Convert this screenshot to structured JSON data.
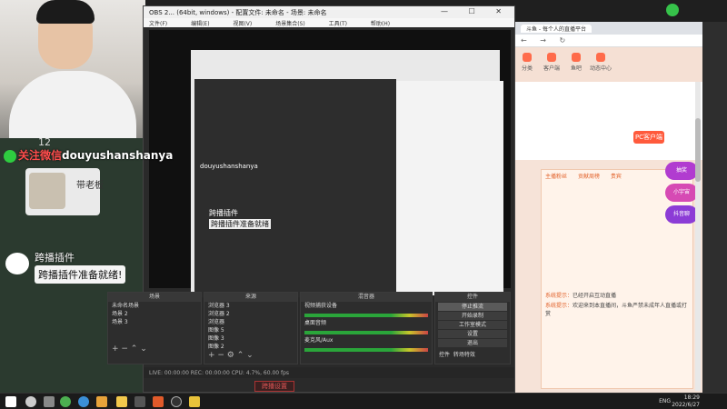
{
  "webcam": {
    "number": "12"
  },
  "overlay": {
    "chat_user_prefix": "关注微信",
    "chat_user_handle": "douyushanshanya",
    "plugin_card_title": "带老板",
    "notice_title": "跨播插件",
    "notice_message": "跨播插件准备就绪!"
  },
  "obs": {
    "title": "OBS 2... (64bit, windows) - 配置文件: 未命名 - 场景: 未命名",
    "menu": [
      "文件(F)",
      "编辑(E)",
      "视图(V)",
      "场景集合(S)",
      "工具(T)",
      "帮助(H)"
    ],
    "window_buttons": "— ☐ ✕",
    "preview_label": "douyushanshanya",
    "preview_sub1": "跨播插件",
    "preview_sub2": "跨播插件准备就绪",
    "docks": {
      "scenes": {
        "title": "场景",
        "items": [
          "未命名场景",
          "场景 2",
          "场景 3"
        ]
      },
      "sources": {
        "title": "来源",
        "items": [
          "浏览器 3",
          "浏览器 2",
          "浏览器",
          "图像 5",
          "图像 3",
          "图像 2"
        ]
      },
      "mixer": {
        "title": "混音器",
        "channels": [
          {
            "name": "视频捕获设备",
            "value": "0.0 dB"
          },
          {
            "name": "桌面音频",
            "value": "0.0 dB"
          },
          {
            "name": "麦克风/Aux",
            "value": "0.0 dB"
          }
        ]
      },
      "controls": {
        "title": "控件",
        "buttons": [
          "停止推流",
          "开始录制",
          "工作室模式",
          "设置",
          "退出"
        ],
        "tabs": [
          "控件",
          "转场特效"
        ]
      }
    },
    "status": "LIVE: 00:00:00    REC: 00:00:00    CPU: 4.7%, 60.00 fps",
    "footer_button": "跨播设置"
  },
  "browser": {
    "tab_title": "斗鱼 - 每个人的直播平台",
    "nav": [
      "分类",
      "客户端",
      "鱼吧",
      "动态中心"
    ],
    "pc_button": "PC客户端",
    "chat_tabs": [
      "主播粉丝",
      "贡献周榜",
      "贵宾"
    ],
    "chat_lines": [
      {
        "user": "系统提示：",
        "text": "已经开启互动直播"
      },
      {
        "user": "系统提示：",
        "text": "欢迎来到本直播间，斗鱼严禁未成年人直播或打赏"
      }
    ],
    "side_bubbles": [
      "抽奖",
      "小宇宙",
      "抖音聊"
    ]
  },
  "taskbar": {
    "lang": "ENG",
    "time": "18:29",
    "date": "2022/6/27"
  },
  "colors": {
    "accent": "#ff5a3c",
    "obs_bg": "#2a2a2a"
  }
}
